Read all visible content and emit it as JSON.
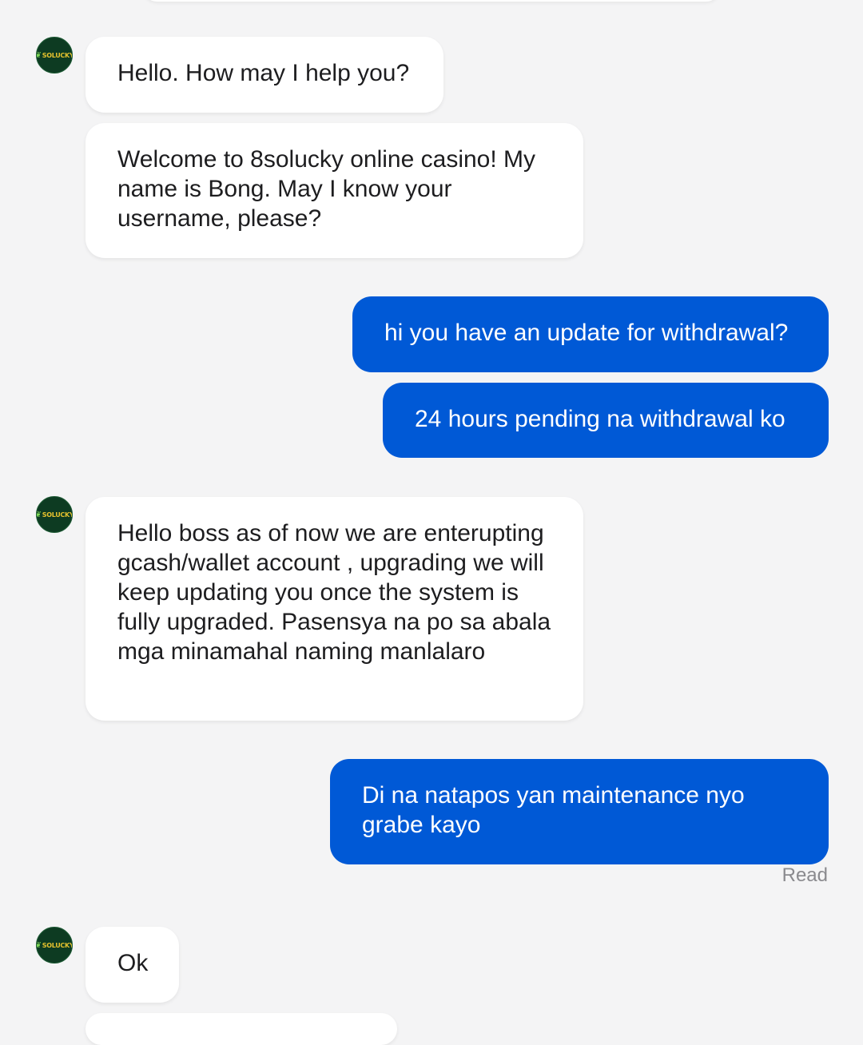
{
  "agent": {
    "avatar_logo": "SOLUCKY"
  },
  "messages": [
    {
      "sender": "agent",
      "text": "Hello. How may I help you?"
    },
    {
      "sender": "agent",
      "text": "Welcome to 8solucky online casino! My name is Bong. May I know your username, please?"
    },
    {
      "sender": "user",
      "text": "hi you have an update for withdrawal?"
    },
    {
      "sender": "user",
      "text": "24 hours pending na withdrawal ko"
    },
    {
      "sender": "agent",
      "text": "Hello boss as of now we are enterupting gcash/wallet account , upgrading we will keep updating you once the system is fully upgraded. Pasensya na po sa abala mga minamahal naming manlalaro"
    },
    {
      "sender": "user",
      "text": "Di na natapos yan maintenance nyo grabe kayo"
    },
    {
      "sender": "agent",
      "text": "Ok"
    }
  ],
  "read_status": "Read",
  "colors": {
    "user_bubble": "#0059d6",
    "agent_bubble": "#ffffff",
    "background": "#f4f4f5",
    "avatar_bg": "#0d3b22"
  }
}
